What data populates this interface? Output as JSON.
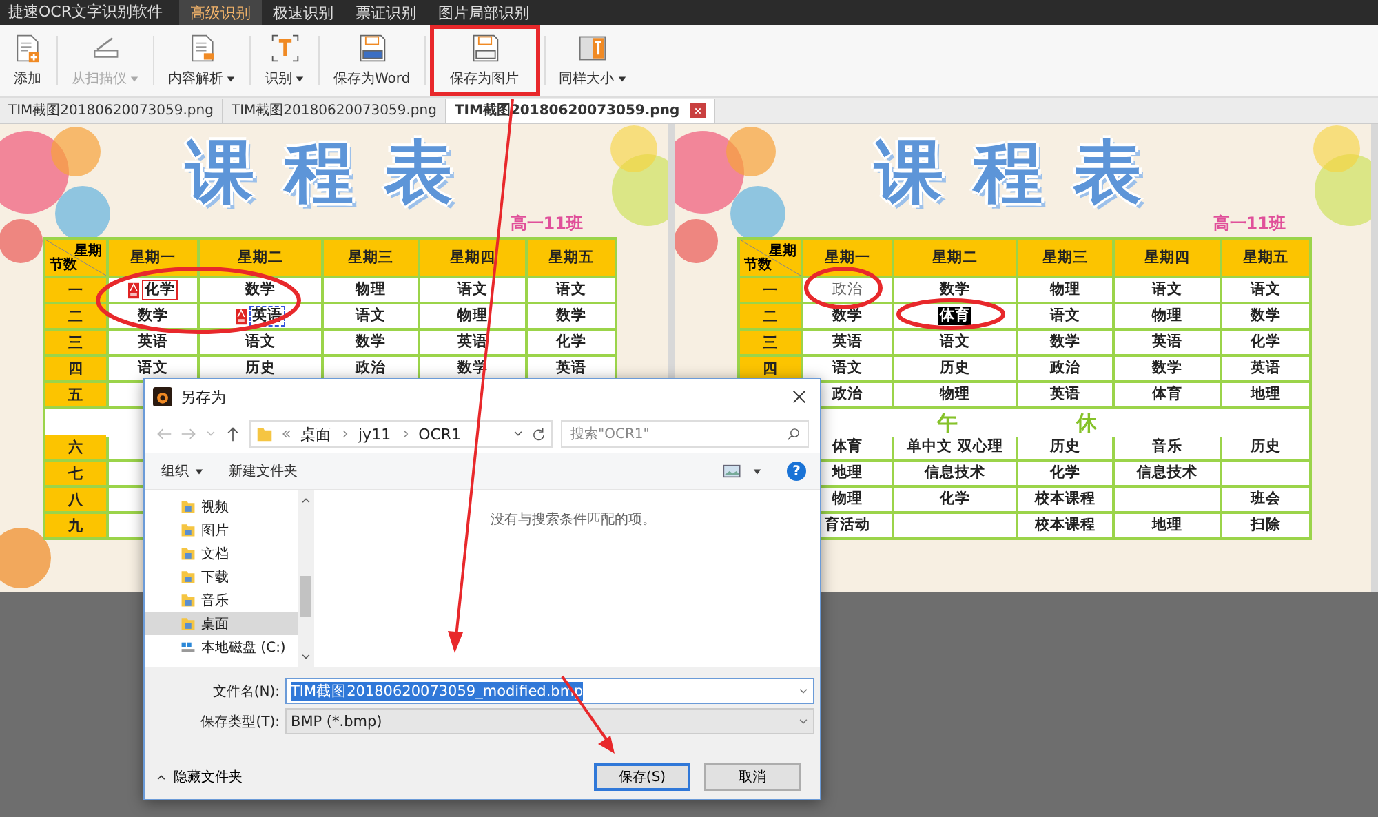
{
  "app": {
    "title": "捷速OCR文字识别软件",
    "menu": [
      {
        "label": "高级识别",
        "selected": true
      },
      {
        "label": "极速识别",
        "selected": false
      },
      {
        "label": "票证识别",
        "selected": false
      },
      {
        "label": "图片局部识别",
        "selected": false
      }
    ]
  },
  "toolbar": [
    {
      "label": "添加",
      "kind": "add",
      "dropdown": false,
      "disabled": false,
      "annotated": false
    },
    {
      "label": "从扫描仪",
      "kind": "scanner",
      "dropdown": true,
      "disabled": true,
      "annotated": false
    },
    {
      "label": "内容解析",
      "kind": "parse",
      "dropdown": true,
      "disabled": false,
      "annotated": false
    },
    {
      "label": "识别",
      "kind": "recognize",
      "dropdown": true,
      "disabled": false,
      "annotated": false
    },
    {
      "label": "保存为Word",
      "kind": "word",
      "dropdown": false,
      "disabled": false,
      "annotated": false
    },
    {
      "label": "保存为图片",
      "kind": "image",
      "dropdown": false,
      "disabled": false,
      "annotated": true
    },
    {
      "label": "同样大小",
      "kind": "size",
      "dropdown": true,
      "disabled": false,
      "annotated": false
    }
  ],
  "tabs": [
    {
      "label": "TIM截图20180620073059.png",
      "selected": false
    },
    {
      "label": "TIM截图20180620073059.png",
      "selected": false
    },
    {
      "label": "TIM截图20180620073059.png",
      "selected": true
    }
  ],
  "panes": [
    {
      "title": "课程表",
      "class_label": "高一11班",
      "table": {
        "corner_top": "星期",
        "corner_bottom": "节数",
        "days": [
          "星期一",
          "星期二",
          "星期三",
          "星期四",
          "星期五"
        ],
        "rows": [
          {
            "label": "一",
            "cells": [
              {
                "text": "化学",
                "kind": "ocr-edited"
              },
              "数学",
              "物理",
              "语文",
              "语文"
            ]
          },
          {
            "label": "二",
            "cells": [
              "数学",
              {
                "text": "英语",
                "kind": "ocr-selected"
              },
              "语文",
              "物理",
              "数学"
            ]
          },
          {
            "label": "三",
            "cells": [
              "英语",
              "语文",
              "数学",
              "英语",
              "化学"
            ]
          },
          {
            "label": "四",
            "cells": [
              "语文",
              "历史",
              "政治",
              "数学",
              "英语"
            ]
          },
          {
            "label": "五"
          },
          {
            "kind": "break"
          },
          {
            "label": "六"
          },
          {
            "label": "七"
          },
          {
            "label": "八"
          },
          {
            "label": "九"
          }
        ]
      }
    },
    {
      "title": "课程表",
      "class_label": "高一11班",
      "table": {
        "corner_top": "星期",
        "corner_bottom": "节数",
        "days": [
          "星期一",
          "星期二",
          "星期三",
          "星期四",
          "星期五"
        ],
        "rows": [
          {
            "label": "一",
            "cells": [
              {
                "text": "政治",
                "kind": "corrected"
              },
              "数学",
              "物理",
              "语文",
              "语文"
            ]
          },
          {
            "label": "二",
            "cells": [
              "数学",
              {
                "text": "体育",
                "kind": "highlighted"
              },
              "语文",
              "物理",
              "数学"
            ]
          },
          {
            "label": "三",
            "cells": [
              "英语",
              "语文",
              "数学",
              "英语",
              "化学"
            ]
          },
          {
            "label": "四",
            "cells": [
              "语文",
              "历史",
              "政治",
              "数学",
              "英语"
            ]
          },
          {
            "cells": [
              "政治",
              "物理",
              "英语",
              "体育",
              "地理"
            ]
          },
          {
            "kind": "break",
            "texts": [
              "午",
              "休"
            ]
          },
          {
            "cells": [
              "体育",
              "单中文  双心理",
              "历史",
              "音乐",
              "历史"
            ]
          },
          {
            "cells": [
              "地理",
              "信息技术",
              "化学",
              "信息技术",
              null
            ]
          },
          {
            "cells": [
              "物理",
              "化学",
              "校本课程",
              null,
              "班会"
            ]
          },
          {
            "cells": [
              "育活动",
              null,
              "校本课程",
              "地理",
              "扫除"
            ]
          }
        ]
      }
    }
  ],
  "dialog": {
    "title": "另存为",
    "breadcrumb": [
      "桌面",
      "jy11",
      "OCR1"
    ],
    "search": {
      "placeholder": "搜索\"OCR1\""
    },
    "organize": "组织",
    "new_folder": "新建文件夹",
    "help": "?",
    "nav": [
      {
        "label": "视频",
        "kind": "folder",
        "selected": false
      },
      {
        "label": "图片",
        "kind": "folder",
        "selected": false
      },
      {
        "label": "文档",
        "kind": "folder",
        "selected": false
      },
      {
        "label": "下载",
        "kind": "folder",
        "selected": false
      },
      {
        "label": "音乐",
        "kind": "folder",
        "selected": false
      },
      {
        "label": "桌面",
        "kind": "folder",
        "selected": true
      },
      {
        "label": "本地磁盘 (C:)",
        "kind": "drive",
        "selected": false
      }
    ],
    "empty_message": "没有与搜索条件匹配的项。",
    "filename": {
      "label": "文件名(N):",
      "value": "TIM截图20180620073059_modified.bmp",
      "selected": true
    },
    "filetype": {
      "label": "保存类型(T):",
      "value": "BMP (*.bmp)"
    },
    "hide_folders": "隐藏文件夹",
    "buttons": [
      {
        "label": "保存(S)",
        "default": true
      },
      {
        "label": "取消",
        "default": false
      }
    ]
  }
}
